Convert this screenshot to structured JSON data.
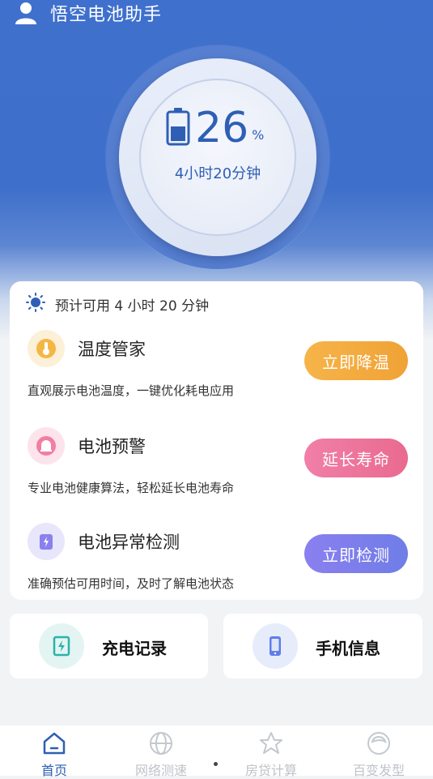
{
  "app": {
    "title": "悟空电池助手"
  },
  "battery": {
    "percent": "26",
    "unit": "%",
    "remaining": "4小时20分钟",
    "level": 0.26
  },
  "estimate": {
    "text": "预计可用 4 小时 20 分钟"
  },
  "features": [
    {
      "title": "温度管家",
      "desc": "直观展示电池温度，一键优化耗电应用",
      "button": "立即降温",
      "icon": "thermometer-icon",
      "btn_color": "#f2a93b"
    },
    {
      "title": "电池预警",
      "desc": "专业电池健康算法，轻松延长电池寿命",
      "button": "延长寿命",
      "icon": "alarm-icon",
      "btn_color": "#ef6f9a"
    },
    {
      "title": "电池异常检测",
      "desc": "准确预估可用时间，及时了解电池状态",
      "button": "立即检测",
      "icon": "battery-check-icon",
      "btn_color": "#7b74e8"
    }
  ],
  "tiles": [
    {
      "label": "充电记录",
      "icon": "charge-record-icon"
    },
    {
      "label": "手机信息",
      "icon": "phone-info-icon"
    }
  ],
  "tabs": [
    {
      "label": "首页",
      "icon": "home-icon",
      "active": true
    },
    {
      "label": "网络测速",
      "icon": "globe-icon",
      "active": false
    },
    {
      "label": "房贷计算",
      "icon": "star-house-icon",
      "active": false
    },
    {
      "label": "百变发型",
      "icon": "hairstyle-icon",
      "active": false
    }
  ],
  "colors": {
    "primary": "#3f70cd",
    "accent_text": "#2f5fb5"
  }
}
